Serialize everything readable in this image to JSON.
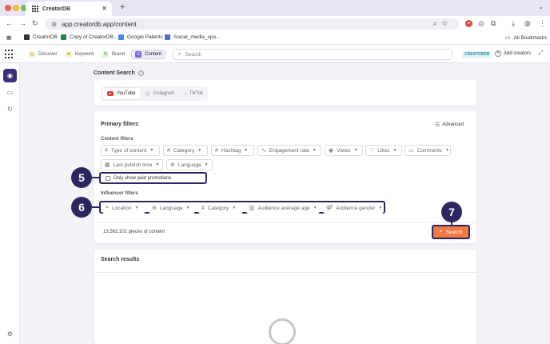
{
  "browser": {
    "tab_title": "CreatorDB",
    "url": "app.creatordb.app/content",
    "bookmarks": [
      {
        "label": "CreatorDB",
        "color": "#333333"
      },
      {
        "label": "Copy of CreatorDB...",
        "color": "#1e8e3e"
      },
      {
        "label": "Google Patents",
        "color": "#4285f4"
      },
      {
        "label": "Social_media_spo...",
        "color": "#4a72c9"
      }
    ],
    "all_bookmarks": "All Bookmarks"
  },
  "nav": {
    "tabs": [
      {
        "label": "Discover",
        "icon": "compass-icon",
        "color": "#f3c97a"
      },
      {
        "label": "Keyword",
        "icon": "key-icon",
        "color": "#f6d37d"
      },
      {
        "label": "Brand",
        "icon": "brand-icon",
        "color": "#9fd59a"
      },
      {
        "label": "Content",
        "icon": "content-icon",
        "color": "#7a6fd0"
      }
    ],
    "search_placeholder": "Search",
    "brand_pill": "CREATORDB",
    "add_creators": "Add creators"
  },
  "content_search": {
    "title": "Content Search",
    "platforms": [
      "YouTube",
      "Instagram",
      "TikTok"
    ],
    "active_platform": "YouTube"
  },
  "primary_filters": {
    "title": "Primary filters",
    "advanced": "Advanced",
    "content_filters_title": "Content filters",
    "content_filters": [
      {
        "label": "Type of content",
        "icon": "#"
      },
      {
        "label": "Category",
        "icon": "#"
      },
      {
        "label": "Hashtag",
        "icon": "#"
      },
      {
        "label": "Engagement rate",
        "icon": "∿"
      },
      {
        "label": "Views",
        "icon": "◉"
      },
      {
        "label": "Likes",
        "icon": "♡"
      },
      {
        "label": "Comments",
        "icon": "▭"
      },
      {
        "label": "Last publish time",
        "icon": "▦"
      },
      {
        "label": "Language",
        "icon": "⊕"
      }
    ],
    "paid_promotions": "Only show paid promotions",
    "influencer_filters_title": "Influencer filters",
    "influencer_filters": [
      {
        "label": "Location",
        "icon": "⌖"
      },
      {
        "label": "Language",
        "icon": "⊕"
      },
      {
        "label": "Category",
        "icon": "#"
      },
      {
        "label": "Audience average age",
        "icon": "▥"
      },
      {
        "label": "Audience gender",
        "icon": "⚤"
      }
    ],
    "count": "13,562,101 pieces of content",
    "search_button": "Search"
  },
  "callouts": [
    "5",
    "6",
    "7"
  ],
  "results": {
    "title": "Search results"
  },
  "colors": {
    "accent": "#2c2760",
    "search_button": "#ef7a45"
  }
}
